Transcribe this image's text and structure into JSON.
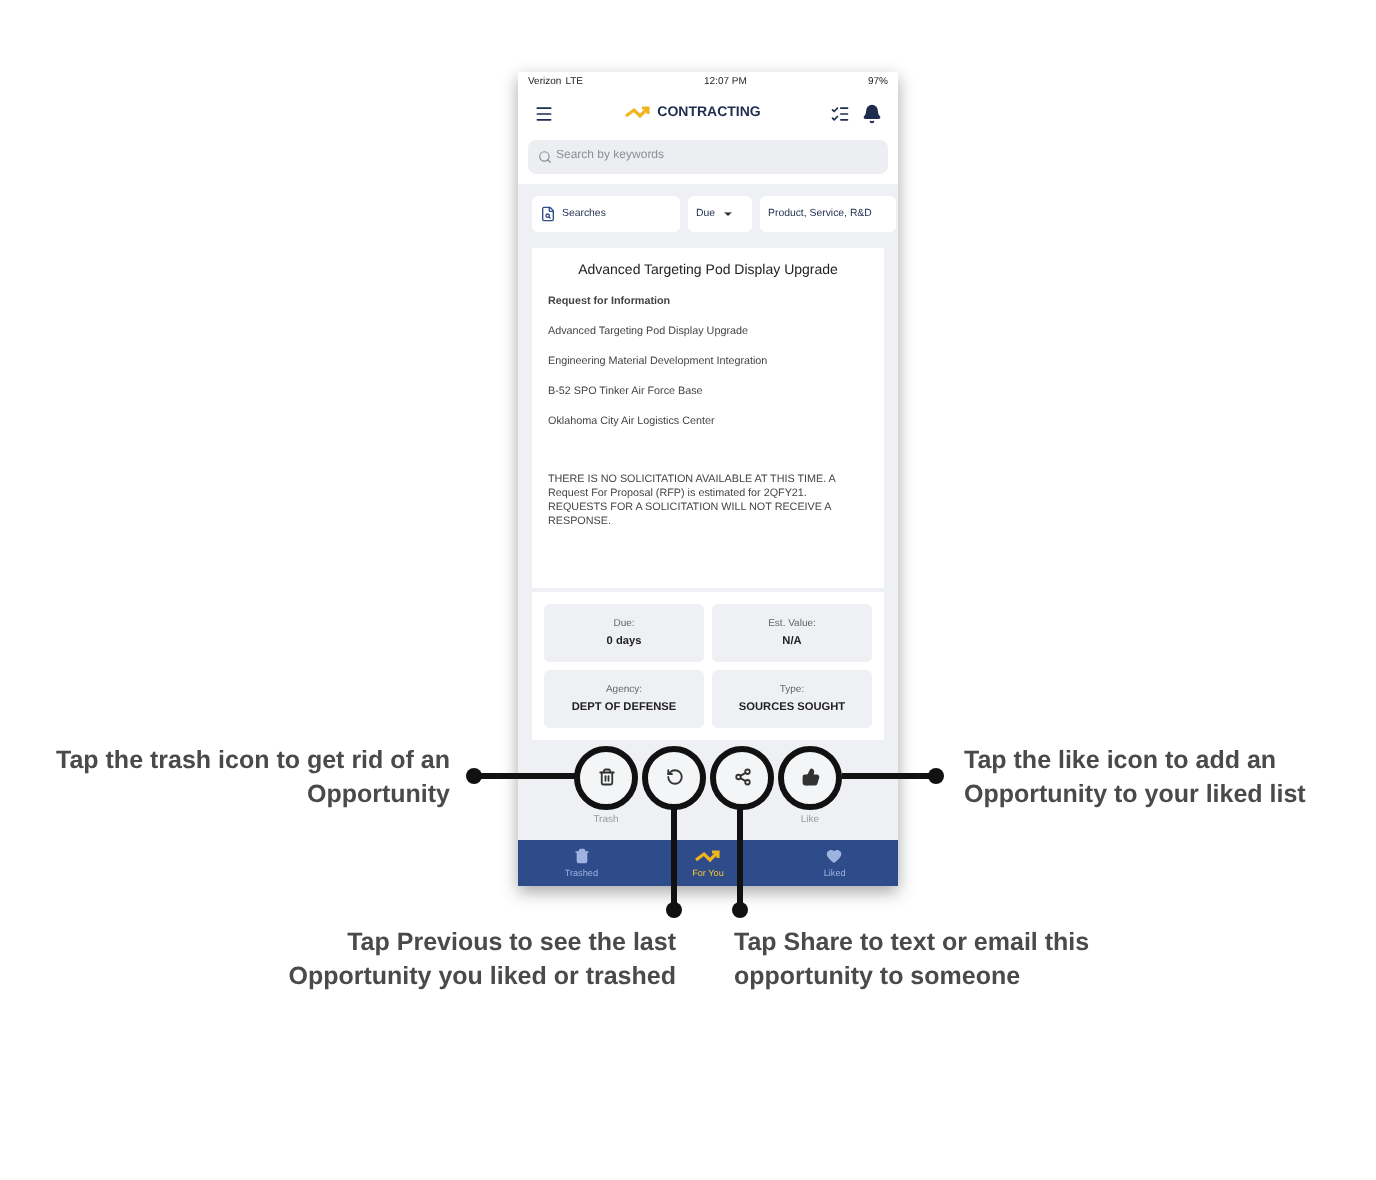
{
  "status_bar": {
    "carrier": "Verizon",
    "network": "LTE",
    "time": "12:07 PM",
    "battery": "97%"
  },
  "header": {
    "title": "CONTRACTING"
  },
  "search": {
    "placeholder": "Search by keywords"
  },
  "filters": [
    {
      "kind": "saved",
      "label": "Searches"
    },
    {
      "kind": "dropdown",
      "label": "Due"
    },
    {
      "kind": "plain",
      "label": "Product, Service, R&D"
    }
  ],
  "card": {
    "title": "Advanced Targeting Pod Display Upgrade",
    "type": "Request for Information",
    "lines": [
      "Advanced Targeting Pod Display Upgrade",
      "Engineering Material Development Integration",
      "B-52 SPO Tinker Air Force Base",
      "Oklahoma City Air Logistics Center"
    ],
    "note": "THERE IS NO SOLICITATION AVAILABLE AT THIS TIME. A Request For Proposal (RFP) is estimated for 2QFY21. REQUESTS FOR A SOLICITATION WILL NOT RECEIVE A RESPONSE."
  },
  "details": [
    {
      "label": "Due:",
      "value": "0 days"
    },
    {
      "label": "Est. Value:",
      "value": "N/A"
    },
    {
      "label": "Agency:",
      "value": "DEPT OF DEFENSE"
    },
    {
      "label": "Type:",
      "value": "SOURCES SOUGHT"
    }
  ],
  "actions": [
    {
      "kind": "trash",
      "label": "Trash"
    },
    {
      "kind": "previous"
    },
    {
      "kind": "share"
    },
    {
      "kind": "like",
      "label": "Like"
    }
  ],
  "nav": [
    {
      "kind": "trash",
      "label": "Trashed",
      "selected": false
    },
    {
      "kind": "logo",
      "label": "For You",
      "selected": true
    },
    {
      "kind": "heart",
      "label": "Liked",
      "selected": false
    }
  ],
  "callouts": [
    {
      "kind": "left",
      "lines": [
        "Tap the trash icon to get rid of an",
        "Opportunity"
      ]
    },
    {
      "kind": "right",
      "lines": [
        "Tap the like icon to add an",
        "Opportunity to your liked list"
      ]
    },
    {
      "kind": "below-left",
      "lines": [
        "Tap Previous to see the last",
        "Opportunity you liked or trashed"
      ]
    },
    {
      "kind": "below-right",
      "lines": [
        "Tap Share to text or email this",
        "opportunity to someone"
      ]
    }
  ]
}
